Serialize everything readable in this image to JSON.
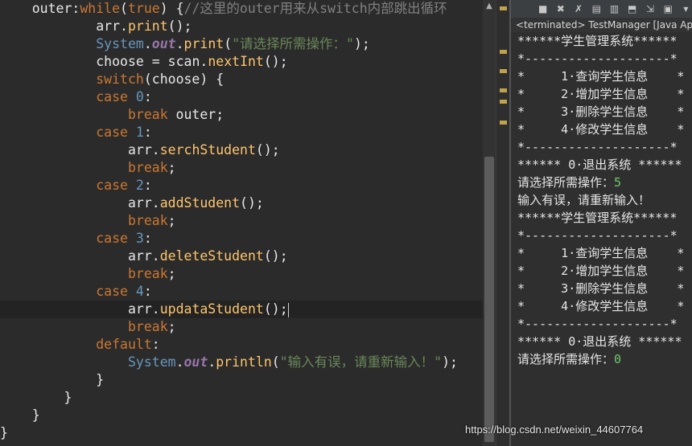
{
  "editor": {
    "lines": [
      {
        "indent": "    ",
        "parts": [
          {
            "t": "outer:",
            "c": "plain"
          },
          {
            "t": "while",
            "c": "kw"
          },
          {
            "t": "(",
            "c": "plain"
          },
          {
            "t": "true",
            "c": "kw"
          },
          {
            "t": ") {",
            "c": "plain"
          },
          {
            "t": "//这里的outer用来从switch内部跳出循环",
            "c": "cmt"
          }
        ]
      },
      {
        "indent": "            ",
        "parts": [
          {
            "t": "arr",
            "c": "plain"
          },
          {
            "t": ".",
            "c": "plain"
          },
          {
            "t": "print",
            "c": "fn"
          },
          {
            "t": "();",
            "c": "plain"
          }
        ]
      },
      {
        "indent": "            ",
        "parts": [
          {
            "t": "System",
            "c": "cls"
          },
          {
            "t": ".",
            "c": "plain"
          },
          {
            "t": "out",
            "c": "fld"
          },
          {
            "t": ".",
            "c": "plain"
          },
          {
            "t": "print",
            "c": "fn"
          },
          {
            "t": "(",
            "c": "plain"
          },
          {
            "t": "\"请选择所需操作：\"",
            "c": "str"
          },
          {
            "t": ");",
            "c": "plain"
          }
        ]
      },
      {
        "indent": "            ",
        "parts": [
          {
            "t": "choose",
            "c": "plain"
          },
          {
            "t": " = ",
            "c": "plain"
          },
          {
            "t": "scan",
            "c": "plain"
          },
          {
            "t": ".",
            "c": "plain"
          },
          {
            "t": "nextInt",
            "c": "fn"
          },
          {
            "t": "();",
            "c": "plain"
          }
        ]
      },
      {
        "indent": "            ",
        "parts": [
          {
            "t": "switch",
            "c": "kw"
          },
          {
            "t": "(choose) {",
            "c": "plain"
          }
        ]
      },
      {
        "indent": "            ",
        "parts": [
          {
            "t": "case",
            "c": "kw"
          },
          {
            "t": " ",
            "c": "plain"
          },
          {
            "t": "0",
            "c": "num"
          },
          {
            "t": ":",
            "c": "plain"
          }
        ]
      },
      {
        "indent": "                ",
        "parts": [
          {
            "t": "break",
            "c": "kw"
          },
          {
            "t": " outer;",
            "c": "plain"
          }
        ]
      },
      {
        "indent": "            ",
        "parts": [
          {
            "t": "case",
            "c": "kw"
          },
          {
            "t": " ",
            "c": "plain"
          },
          {
            "t": "1",
            "c": "num"
          },
          {
            "t": ":",
            "c": "plain"
          }
        ]
      },
      {
        "indent": "                ",
        "parts": [
          {
            "t": "arr",
            "c": "plain"
          },
          {
            "t": ".",
            "c": "plain"
          },
          {
            "t": "serchStudent",
            "c": "fn"
          },
          {
            "t": "();",
            "c": "plain"
          }
        ]
      },
      {
        "indent": "                ",
        "parts": [
          {
            "t": "break",
            "c": "kw"
          },
          {
            "t": ";",
            "c": "plain"
          }
        ]
      },
      {
        "indent": "            ",
        "parts": [
          {
            "t": "case",
            "c": "kw"
          },
          {
            "t": " ",
            "c": "plain"
          },
          {
            "t": "2",
            "c": "num"
          },
          {
            "t": ":",
            "c": "plain"
          }
        ]
      },
      {
        "indent": "                ",
        "parts": [
          {
            "t": "arr",
            "c": "plain"
          },
          {
            "t": ".",
            "c": "plain"
          },
          {
            "t": "addStudent",
            "c": "fn"
          },
          {
            "t": "();",
            "c": "plain"
          }
        ]
      },
      {
        "indent": "                ",
        "parts": [
          {
            "t": "break",
            "c": "kw"
          },
          {
            "t": ";",
            "c": "plain"
          }
        ]
      },
      {
        "indent": "            ",
        "parts": [
          {
            "t": "case",
            "c": "kw"
          },
          {
            "t": " ",
            "c": "plain"
          },
          {
            "t": "3",
            "c": "num"
          },
          {
            "t": ":",
            "c": "plain"
          }
        ]
      },
      {
        "indent": "                ",
        "parts": [
          {
            "t": "arr",
            "c": "plain"
          },
          {
            "t": ".",
            "c": "plain"
          },
          {
            "t": "deleteStudent",
            "c": "fn"
          },
          {
            "t": "();",
            "c": "plain"
          }
        ]
      },
      {
        "indent": "                ",
        "parts": [
          {
            "t": "break",
            "c": "kw"
          },
          {
            "t": ";",
            "c": "plain"
          }
        ]
      },
      {
        "indent": "            ",
        "parts": [
          {
            "t": "case",
            "c": "kw"
          },
          {
            "t": " ",
            "c": "plain"
          },
          {
            "t": "4",
            "c": "num"
          },
          {
            "t": ":",
            "c": "plain"
          }
        ]
      },
      {
        "indent": "                ",
        "parts": [
          {
            "t": "arr",
            "c": "plain"
          },
          {
            "t": ".",
            "c": "plain"
          },
          {
            "t": "updataStudent",
            "c": "fn"
          },
          {
            "t": "();",
            "c": "plain"
          }
        ],
        "active": true,
        "caret": true
      },
      {
        "indent": "                ",
        "parts": [
          {
            "t": "break",
            "c": "kw"
          },
          {
            "t": ";",
            "c": "plain"
          }
        ]
      },
      {
        "indent": "            ",
        "parts": [
          {
            "t": "default",
            "c": "kw"
          },
          {
            "t": ":",
            "c": "plain"
          }
        ]
      },
      {
        "indent": "                ",
        "parts": [
          {
            "t": "System",
            "c": "cls"
          },
          {
            "t": ".",
            "c": "plain"
          },
          {
            "t": "out",
            "c": "fld"
          },
          {
            "t": ".",
            "c": "plain"
          },
          {
            "t": "println",
            "c": "fn"
          },
          {
            "t": "(",
            "c": "plain"
          },
          {
            "t": "\"输入有误，请重新输入！\"",
            "c": "str"
          },
          {
            "t": ");",
            "c": "plain"
          }
        ]
      },
      {
        "indent": "            ",
        "parts": [
          {
            "t": "}",
            "c": "plain"
          }
        ]
      },
      {
        "indent": "        ",
        "parts": [
          {
            "t": "}",
            "c": "plain"
          }
        ]
      },
      {
        "indent": "    ",
        "parts": [
          {
            "t": "}",
            "c": "plain"
          }
        ]
      },
      {
        "indent": "",
        "parts": [
          {
            "t": "}",
            "c": "plain"
          }
        ]
      }
    ]
  },
  "console": {
    "status": "<terminated> TestManager [Java Application]",
    "toolbar_icons": [
      "terminate-icon",
      "remove-launch-icon",
      "remove-all-icon",
      "scroll-lock-icon",
      "clear-console-icon",
      "word-wrap-icon",
      "pin-console-icon",
      "display-console-icon",
      "open-console-icon"
    ],
    "lines": [
      {
        "text": "******学生管理系统******"
      },
      {
        "text": "*--------------------*"
      },
      {
        "text": "*     1·查询学生信息    *"
      },
      {
        "text": "*     2·增加学生信息    *"
      },
      {
        "text": "*     3·删除学生信息    *"
      },
      {
        "text": "*     4·修改学生信息    *"
      },
      {
        "text": "*--------------------*"
      },
      {
        "text": "****** 0·退出系统 ******"
      },
      {
        "prompt": "请选择所需操作：",
        "input": "5"
      },
      {
        "text": "输入有误，请重新输入！"
      },
      {
        "text": "******学生管理系统******"
      },
      {
        "text": "*--------------------*"
      },
      {
        "text": "*     1·查询学生信息    *"
      },
      {
        "text": "*     2·增加学生信息    *"
      },
      {
        "text": "*     3·删除学生信息    *"
      },
      {
        "text": "*     4·修改学生信息    *"
      },
      {
        "text": "*--------------------*"
      },
      {
        "text": "****** 0·退出系统 ******"
      },
      {
        "prompt": "请选择所需操作：",
        "input": "0"
      }
    ]
  },
  "watermark": "https://blog.csdn.net/weixin_44607764",
  "colors": {
    "keyword": "#cc7832",
    "method": "#ffc66d",
    "string": "#6a8759",
    "comment": "#808080",
    "class": "#6897bb",
    "console_input": "#6fc86f"
  }
}
